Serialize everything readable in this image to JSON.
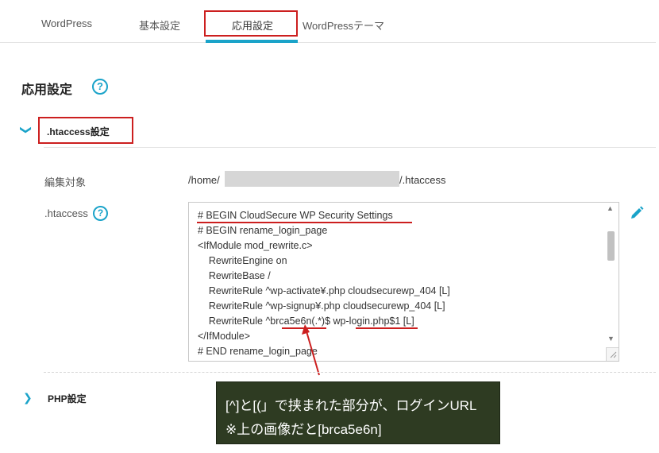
{
  "tabs": [
    {
      "label": "WordPress"
    },
    {
      "label": "基本設定"
    },
    {
      "label": "応用設定",
      "active": true
    },
    {
      "label": "WordPressテーマ"
    }
  ],
  "page": {
    "title": "応用設定",
    "help": "?"
  },
  "sections": {
    "htaccess": {
      "label": ".htaccess設定",
      "expanded": true,
      "edit_target_label": "編集対象",
      "path_prefix": "/home/",
      "path_suffix": "/.htaccess",
      "htaccess_label": ".htaccess",
      "help": "?",
      "code_lines": [
        "# BEGIN CloudSecure WP Security Settings",
        "# BEGIN rename_login_page",
        "<IfModule mod_rewrite.c>",
        "    RewriteEngine on",
        "    RewriteBase /",
        "    RewriteRule ^wp-activate¥.php cloudsecurewp_404 [L]",
        "    RewriteRule ^wp-signup¥.php cloudsecurewp_404 [L]",
        "    RewriteRule ^brca5e6n(.*)$ wp-login.php$1 [L]",
        "</IfModule>",
        "# END rename_login_page"
      ]
    },
    "php": {
      "label": "PHP設定",
      "expanded": false
    }
  },
  "icons": {
    "chevron": "chevron-icon",
    "help": "question-circle-icon",
    "edit": "pencil-icon",
    "scroll_up": "▲",
    "scroll_down": "▼"
  },
  "callout": {
    "line1": "[^]と[(」で挟まれた部分が、ログインURL",
    "line2": "※上の画像だと[brca5e6n]"
  },
  "colors": {
    "accent": "#1aa3c9",
    "annotation_red": "#cc1f1f",
    "callout_bg": "#2e3b22"
  }
}
